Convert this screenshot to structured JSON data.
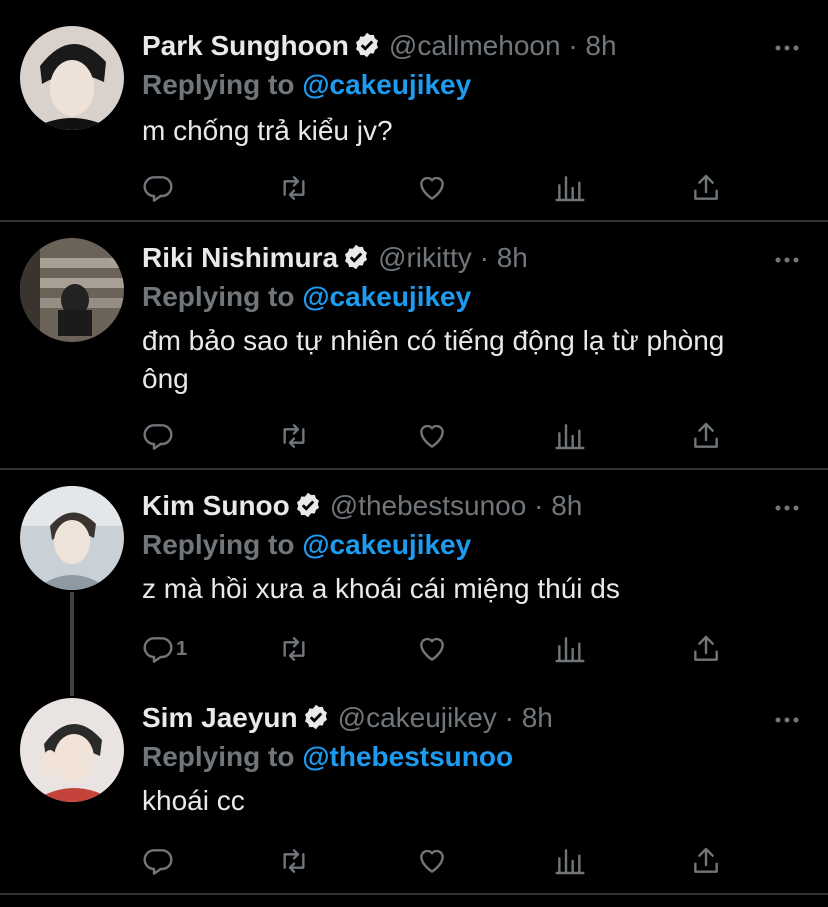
{
  "colors": {
    "background": "#000000",
    "text": "#e7e9ea",
    "muted": "#71767b",
    "accent": "#1d9bf0",
    "divider": "#2f3336"
  },
  "icons": {
    "verified": "verified-badge-icon",
    "more": "more-options-icon",
    "reply": "reply-icon",
    "retweet": "retweet-icon",
    "like": "like-icon",
    "analytics": "analytics-icon",
    "share": "share-icon"
  },
  "tweets": [
    {
      "name": "Park Sunghoon",
      "handle": "@callmehoon",
      "dot": "·",
      "time": "8h",
      "replying_prefix": "Replying to",
      "replying_to": "@cakeujikey",
      "text": "m chống trả kiểu jv?",
      "reply_count": ""
    },
    {
      "name": "Riki Nishimura",
      "handle": "@rikitty",
      "dot": "·",
      "time": "8h",
      "replying_prefix": "Replying to",
      "replying_to": "@cakeujikey",
      "text": "đm bảo sao tự nhiên có tiếng động lạ từ phòng ông",
      "reply_count": ""
    },
    {
      "name": "Kim Sunoo",
      "handle": "@thebestsunoo",
      "dot": "·",
      "time": "8h",
      "replying_prefix": "Replying to",
      "replying_to": "@cakeujikey",
      "text": "z mà hồi xưa a khoái cái miệng thúi ds",
      "reply_count": "1"
    },
    {
      "name": "Sim Jaeyun",
      "handle": "@cakeujikey",
      "dot": "·",
      "time": "8h",
      "replying_prefix": "Replying to",
      "replying_to": "@thebestsunoo",
      "text": "khoái cc",
      "reply_count": ""
    }
  ]
}
